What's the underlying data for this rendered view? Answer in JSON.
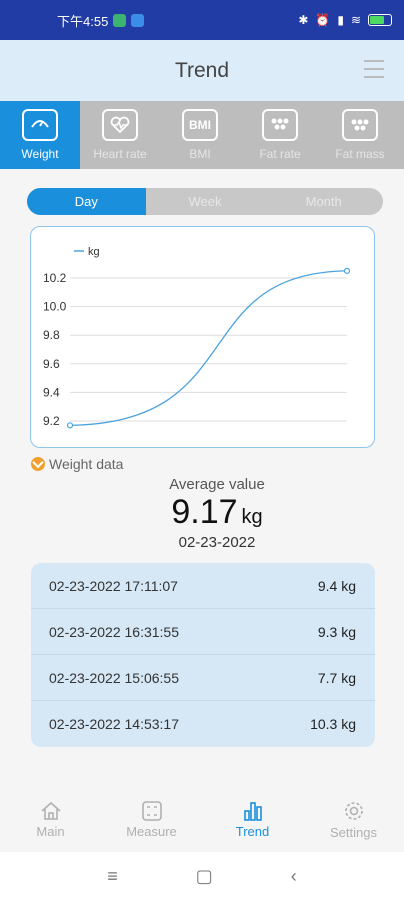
{
  "status_bar": {
    "time": "下午4:55",
    "battery": ""
  },
  "header": {
    "title": "Trend"
  },
  "categories": [
    {
      "label": "Weight",
      "icon": "scale-icon",
      "active": true
    },
    {
      "label": "Heart rate",
      "icon": "heart-rate-icon",
      "active": false
    },
    {
      "label": "BMI",
      "icon": "bmi-icon",
      "active": false
    },
    {
      "label": "Fat rate",
      "icon": "fat-rate-icon",
      "active": false
    },
    {
      "label": "Fat mass",
      "icon": "fat-mass-icon",
      "active": false
    }
  ],
  "segments": {
    "day": "Day",
    "week": "Week",
    "month": "Month",
    "selected": "Day"
  },
  "chart_data": {
    "type": "line",
    "legend": "kg",
    "y_ticks": [
      "10.2",
      "10.0",
      "9.8",
      "9.6",
      "9.4",
      "9.2"
    ],
    "ylim": [
      9.2,
      10.2
    ],
    "series": [
      {
        "name": "kg",
        "points": [
          9.17,
          10.25
        ]
      }
    ],
    "color": "#4aa3df",
    "grid": true
  },
  "weight_data": {
    "label": "Weight data",
    "average_title": "Average value",
    "average_value": "9.17",
    "average_unit": "kg",
    "date": "02-23-2022"
  },
  "records": [
    {
      "time": "02-23-2022 17:11:07",
      "value": "9.4 kg"
    },
    {
      "time": "02-23-2022 16:31:55",
      "value": "9.3 kg"
    },
    {
      "time": "02-23-2022 15:06:55",
      "value": "7.7 kg"
    },
    {
      "time": "02-23-2022 14:53:17",
      "value": "10.3 kg"
    }
  ],
  "bottom_nav": {
    "main": "Main",
    "measure": "Measure",
    "trend": "Trend",
    "settings": "Settings"
  },
  "colors": {
    "accent": "#1a8fdc",
    "statusbar": "#223ca6",
    "header": "#dcecf8"
  }
}
